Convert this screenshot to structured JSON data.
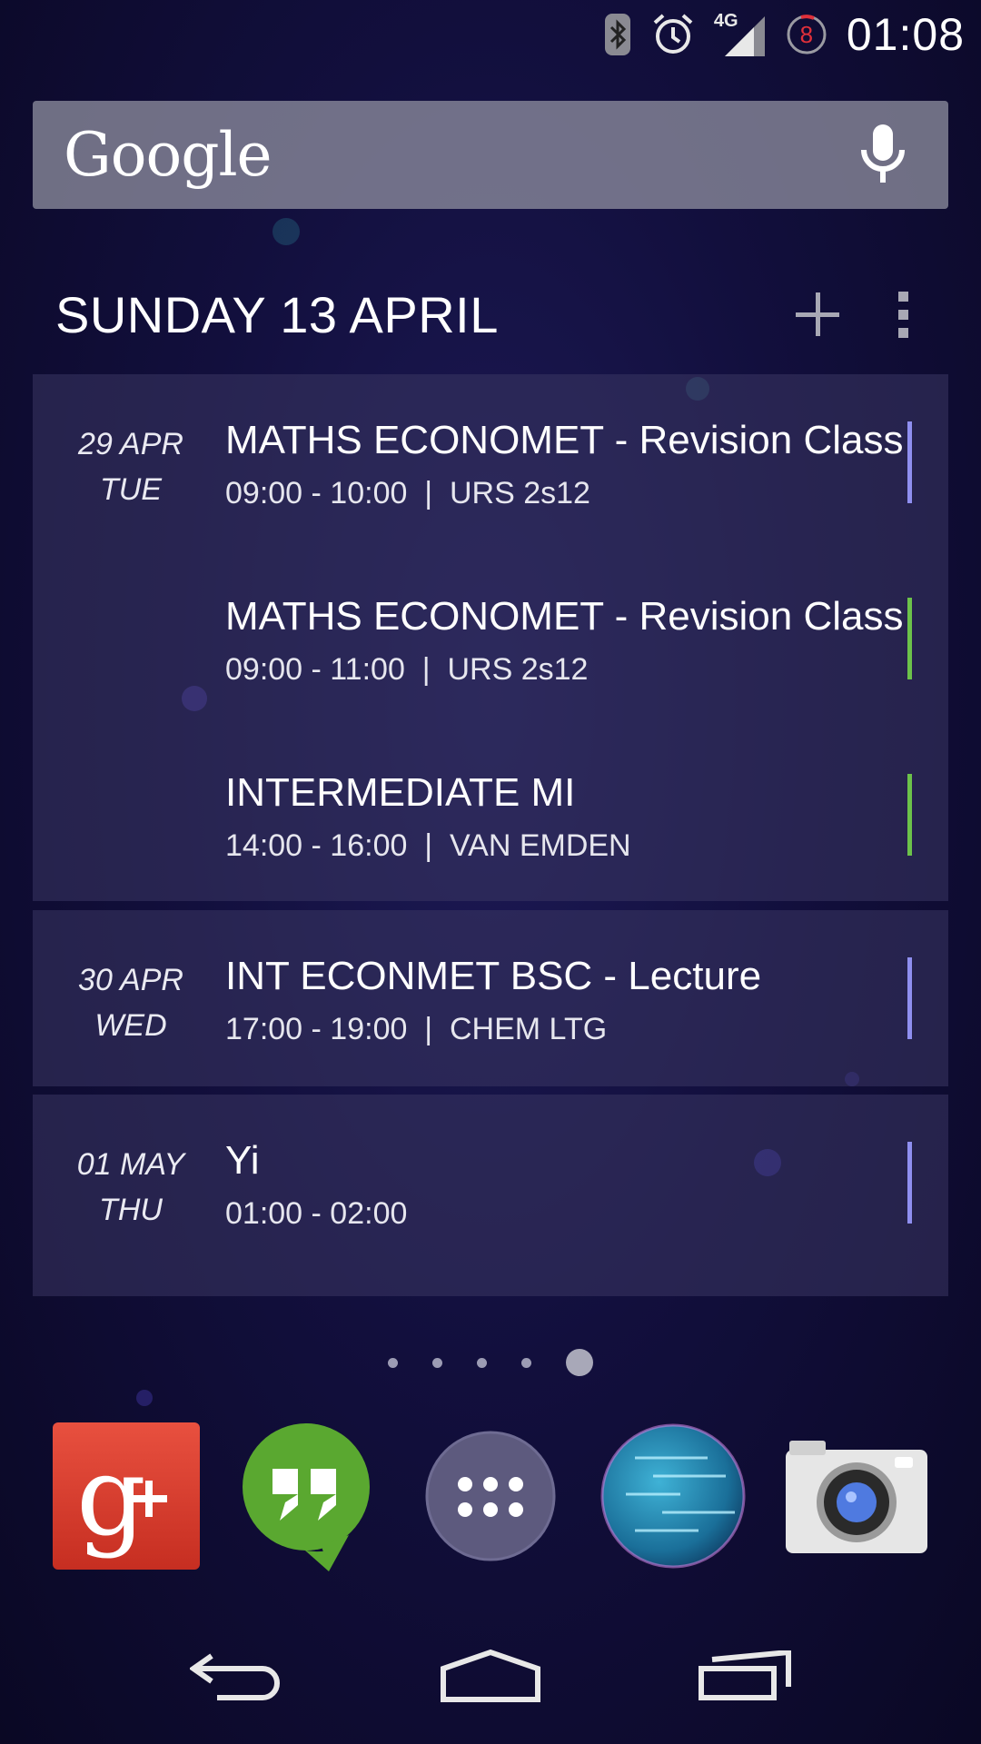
{
  "status_bar": {
    "icons": [
      "bluetooth-icon",
      "alarm-icon",
      "signal-4g-icon",
      "notification-badge"
    ],
    "network_label": "4G",
    "badge_count": "8",
    "time": "01:08"
  },
  "search": {
    "logo_text": "Google",
    "mic_icon": "microphone-icon"
  },
  "calendar_widget": {
    "date_heading": "SUNDAY 13 APRIL",
    "add_icon": "plus-icon",
    "menu_icon": "overflow-menu-icon",
    "days": [
      {
        "day_line1": "29 APR",
        "day_line2": "TUE",
        "events": [
          {
            "title": "MATHS ECONOMET - Revision Class",
            "detail": "09:00 - 10:00  |  URS 2s12",
            "color": "#8f8ff0"
          },
          {
            "title": "MATHS ECONOMET - Revision Class",
            "detail": "09:00 - 11:00  |  URS 2s12",
            "color": "#6cc24a"
          },
          {
            "title": "INTERMEDIATE MI",
            "detail": "14:00 - 16:00  |  VAN EMDEN",
            "color": "#6cc24a"
          }
        ]
      },
      {
        "day_line1": "30 APR",
        "day_line2": "WED",
        "events": [
          {
            "title": "INT ECONMET BSC - Lecture",
            "detail": "17:00 - 19:00  |  CHEM LTG",
            "color": "#8f8ff0"
          }
        ]
      },
      {
        "day_line1": "01 MAY",
        "day_line2": "THU",
        "events": [
          {
            "title": "Yi",
            "detail": "01:00 - 02:00",
            "color": "#8f8ff0"
          }
        ]
      }
    ]
  },
  "pager": {
    "pages": 5,
    "active_page": 5
  },
  "dock": {
    "apps": [
      "google-plus-icon",
      "hangouts-icon",
      "app-drawer-icon",
      "globe-icon",
      "camera-icon"
    ]
  },
  "nav_bar": {
    "buttons": [
      "back-icon",
      "home-icon",
      "recents-icon"
    ]
  },
  "colors": {
    "background": "#120f3d",
    "widget_bg": "#2a2752",
    "accent_purple": "#8f8ff0",
    "accent_green": "#6cc24a",
    "google_plus_red": "#d53b2c",
    "hangouts_green": "#5aa830"
  }
}
